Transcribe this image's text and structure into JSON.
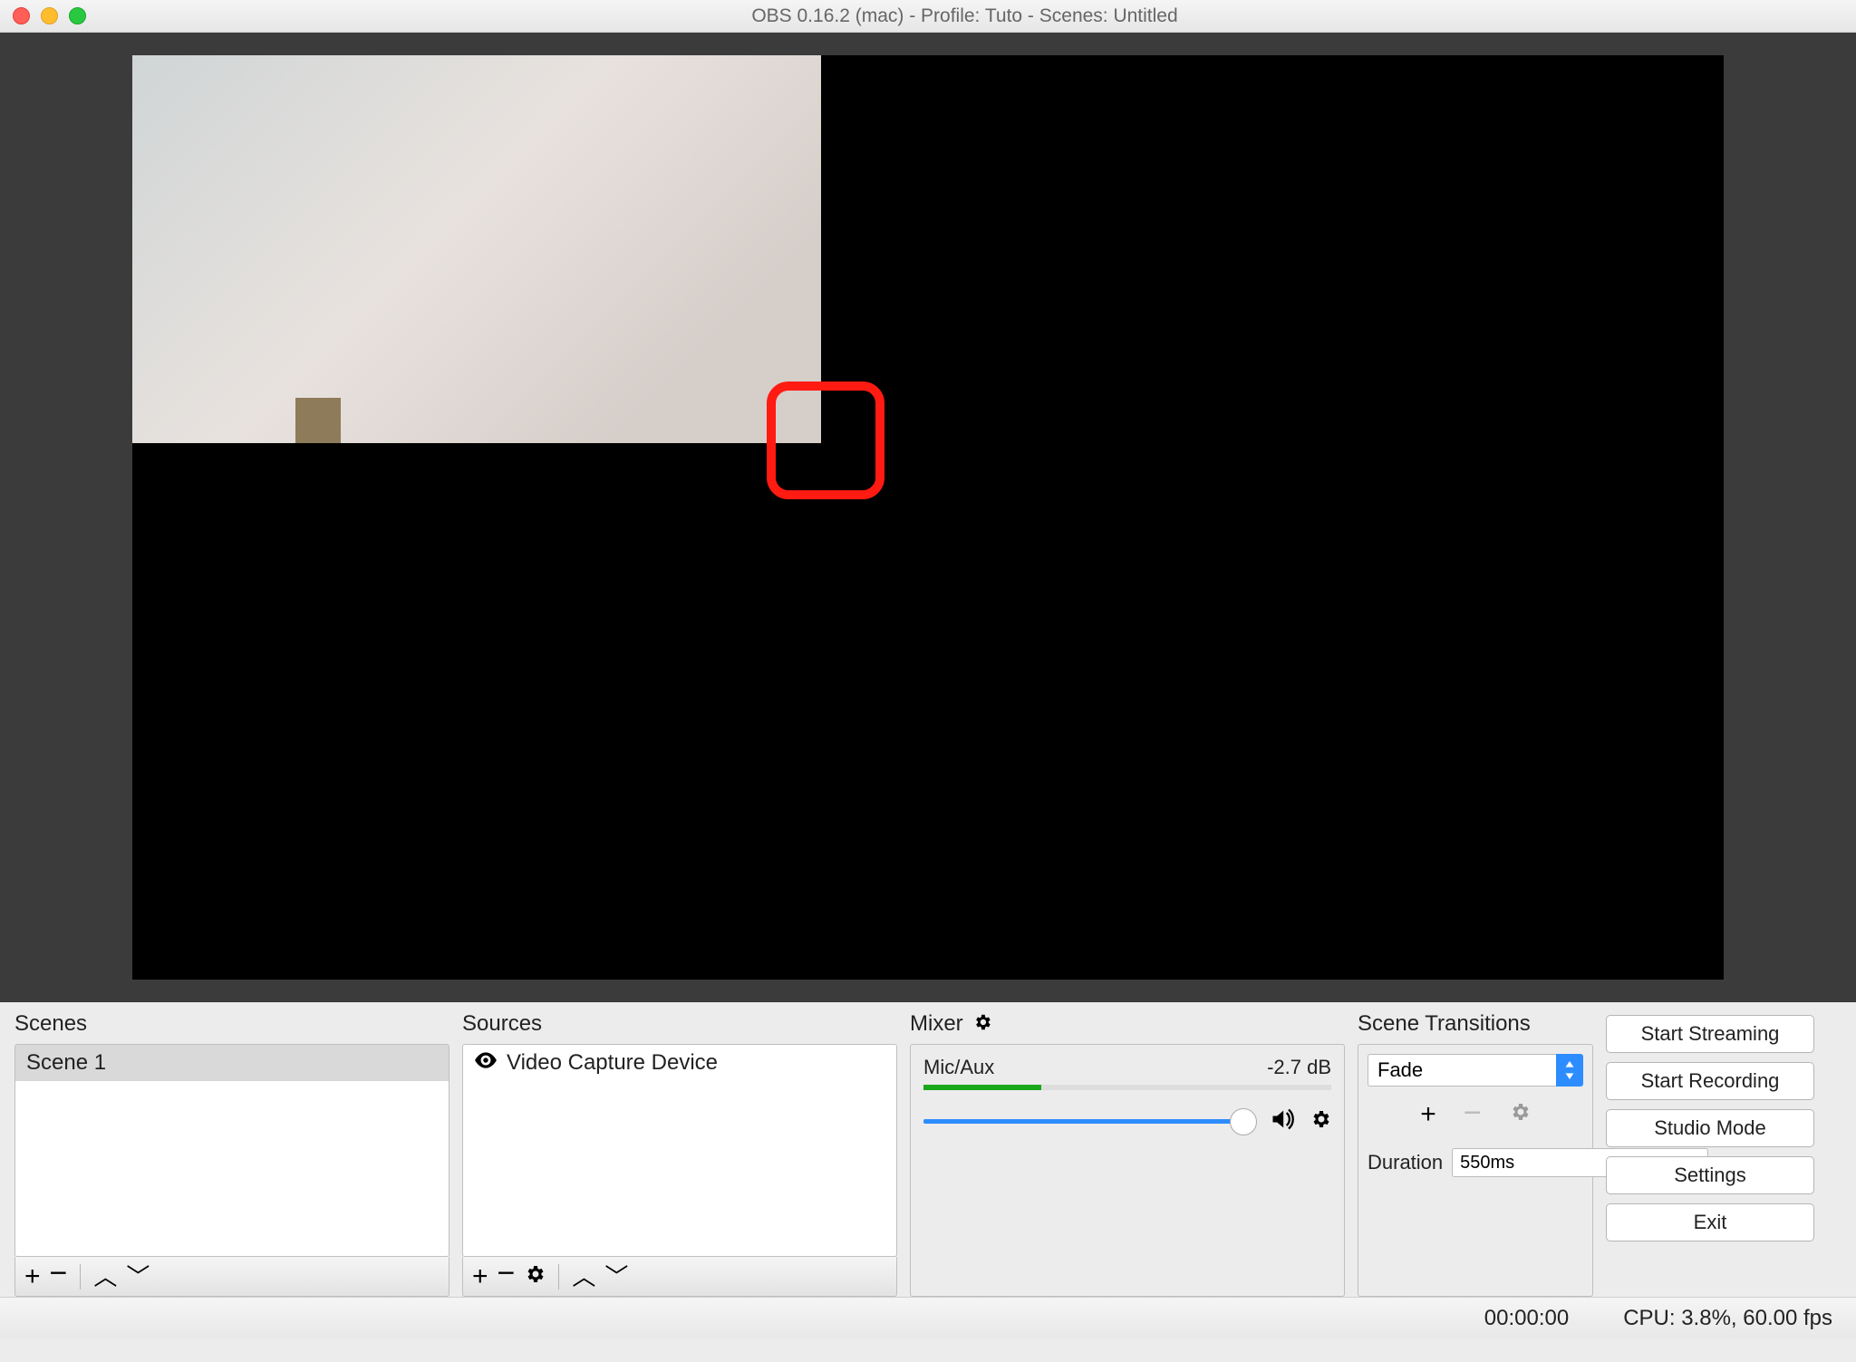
{
  "window": {
    "title": "OBS 0.16.2 (mac) - Profile: Tuto - Scenes: Untitled"
  },
  "panels": {
    "scenes": {
      "title": "Scenes",
      "items": [
        {
          "label": "Scene 1"
        }
      ]
    },
    "sources": {
      "title": "Sources",
      "items": [
        {
          "label": "Video Capture Device"
        }
      ]
    },
    "mixer": {
      "title": "Mixer",
      "channel": {
        "name": "Mic/Aux",
        "level": "-2.7 dB"
      }
    },
    "transitions": {
      "title": "Scene Transitions",
      "selected": "Fade",
      "duration_label": "Duration",
      "duration_value": "550ms"
    },
    "controls": {
      "start_streaming": "Start Streaming",
      "start_recording": "Start Recording",
      "studio_mode": "Studio Mode",
      "settings": "Settings",
      "exit": "Exit"
    }
  },
  "status": {
    "time": "00:00:00",
    "cpu": "CPU: 3.8%, 60.00 fps"
  }
}
